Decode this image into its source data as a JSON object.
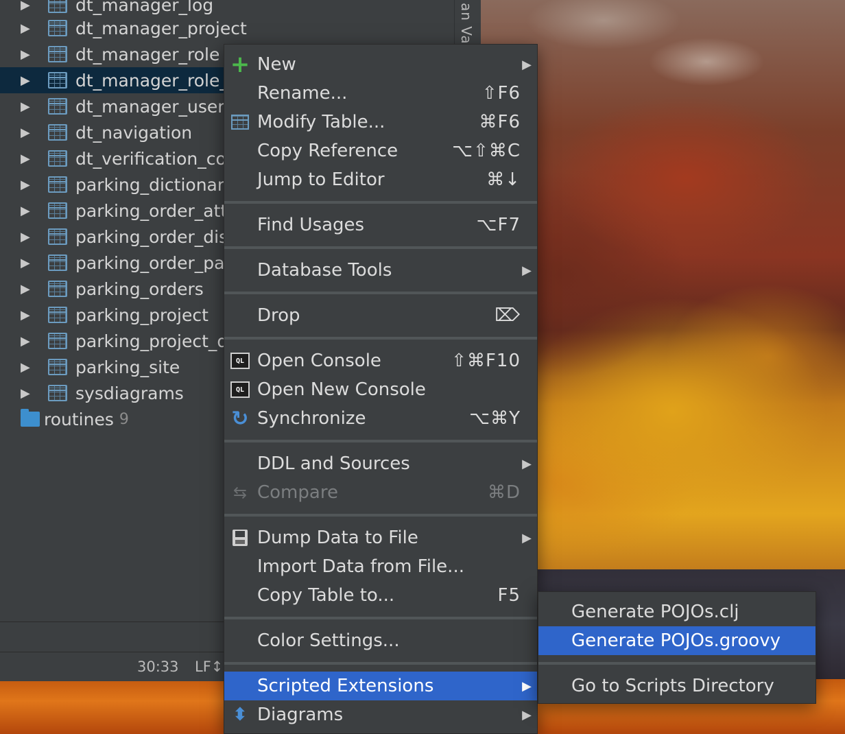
{
  "side_strip": {
    "label": "an Val"
  },
  "tree": {
    "items": [
      {
        "label": "dt_manager_log"
      },
      {
        "label": "dt_manager_project"
      },
      {
        "label": "dt_manager_role"
      },
      {
        "label": "dt_manager_role_"
      },
      {
        "label": "dt_manager_user_"
      },
      {
        "label": "dt_navigation"
      },
      {
        "label": "dt_verification_co"
      },
      {
        "label": "parking_dictionary"
      },
      {
        "label": "parking_order_att"
      },
      {
        "label": "parking_order_dis"
      },
      {
        "label": "parking_order_pay"
      },
      {
        "label": "parking_orders"
      },
      {
        "label": "parking_project"
      },
      {
        "label": "parking_project_d"
      },
      {
        "label": "parking_site"
      },
      {
        "label": "sysdiagrams"
      }
    ],
    "routines": {
      "label": "routines",
      "count": "9"
    }
  },
  "status": {
    "position": "30:33",
    "line_ending": "LF↕"
  },
  "menu": {
    "new": {
      "label": "New"
    },
    "rename": {
      "label": "Rename...",
      "shortcut": "⇧F6"
    },
    "modify_table": {
      "label": "Modify Table...",
      "shortcut": "⌘F6"
    },
    "copy_reference": {
      "label": "Copy Reference",
      "shortcut": "⌥⇧⌘C"
    },
    "jump_to_editor": {
      "label": "Jump to Editor",
      "shortcut": "⌘↓"
    },
    "find_usages": {
      "label": "Find Usages",
      "shortcut": "⌥F7"
    },
    "database_tools": {
      "label": "Database Tools"
    },
    "drop": {
      "label": "Drop",
      "shortcut": "⌦"
    },
    "open_console": {
      "label": "Open Console",
      "shortcut": "⇧⌘F10"
    },
    "open_new_console": {
      "label": "Open New Console"
    },
    "synchronize": {
      "label": "Synchronize",
      "shortcut": "⌥⌘Y"
    },
    "ddl_sources": {
      "label": "DDL and Sources"
    },
    "compare": {
      "label": "Compare",
      "shortcut": "⌘D"
    },
    "dump_data": {
      "label": "Dump Data to File"
    },
    "import_data": {
      "label": "Import Data from File..."
    },
    "copy_table": {
      "label": "Copy Table to...",
      "shortcut": "F5"
    },
    "color_settings": {
      "label": "Color Settings..."
    },
    "scripted_extensions": {
      "label": "Scripted Extensions"
    },
    "diagrams": {
      "label": "Diagrams"
    },
    "submenu_arrow": "▶"
  },
  "submenu": {
    "gen_clj": {
      "label": "Generate POJOs.clj"
    },
    "gen_groovy": {
      "label": "Generate POJOs.groovy"
    },
    "go_scripts": {
      "label": "Go to Scripts Directory"
    }
  },
  "icons": {
    "tree_arrow": "▶",
    "ql_icon_text": "QL"
  },
  "colors": {
    "highlight": "#2f65ca",
    "selected_row": "#0d293e",
    "panel_bg": "#3c3f41",
    "add_green": "#4cb84c"
  }
}
